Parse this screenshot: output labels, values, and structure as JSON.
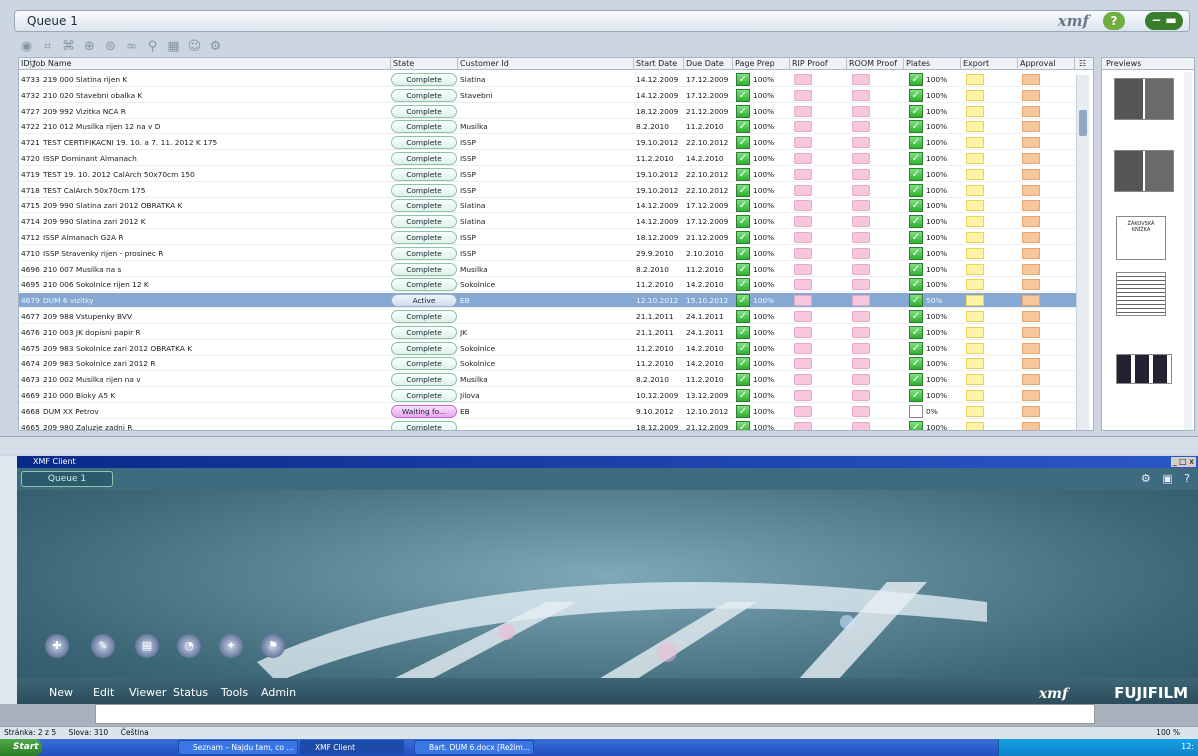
{
  "window": {
    "title": "Queue 1",
    "logo": "xmf",
    "help": "?",
    "minimize": "− ▬"
  },
  "toolbar_icons": [
    "eye-icon",
    "collapse-icon",
    "expand-icon",
    "refresh-icon",
    "filter-icon",
    "link-icon",
    "search-icon",
    "calendar-icon",
    "users-icon",
    "settings-icon"
  ],
  "columns": [
    "ID▽",
    "Job Name",
    "State",
    "Customer Id",
    "Start Date",
    "Due Date",
    "Page Prep",
    "RIP Proof",
    "ROOM Proof",
    "Plates",
    "Export",
    "Approval"
  ],
  "rows": [
    {
      "id": "4733",
      "name": "219 000 Slatina rijen K",
      "state": "Complete",
      "cust": "Slatina",
      "start": "14.12.2009",
      "due": "17.12.2009",
      "prep": "100%",
      "plates": "100%"
    },
    {
      "id": "4732",
      "name": "210 020 Stavebni obalka K",
      "state": "Complete",
      "cust": "Stavebni",
      "start": "14.12.2009",
      "due": "17.12.2009",
      "prep": "100%",
      "plates": "100%"
    },
    {
      "id": "4727",
      "name": "209 992 Vizitka NCA R",
      "state": "Complete",
      "cust": "",
      "start": "18.12.2009",
      "due": "21.12.2009",
      "prep": "100%",
      "plates": "100%"
    },
    {
      "id": "4722",
      "name": "210 012 Musilka rijen 12 na v D",
      "state": "Complete",
      "cust": "Musilka",
      "start": "8.2.2010",
      "due": "11.2.2010",
      "prep": "100%",
      "plates": "100%"
    },
    {
      "id": "4721",
      "name": "TEST CERTIFIKACNI 19. 10. a 7. 11. 2012 K 175",
      "state": "Complete",
      "cust": "ISSP",
      "start": "19.10.2012",
      "due": "22.10.2012",
      "prep": "100%",
      "plates": "100%"
    },
    {
      "id": "4720",
      "name": "ISSP Dominant Almanach",
      "state": "Complete",
      "cust": "ISSP",
      "start": "11.2.2010",
      "due": "14.2.2010",
      "prep": "100%",
      "plates": "100%"
    },
    {
      "id": "4719",
      "name": "TEST 19. 10. 2012 CalArch 50x70cm 150",
      "state": "Complete",
      "cust": "ISSP",
      "start": "19.10.2012",
      "due": "22.10.2012",
      "prep": "100%",
      "plates": "100%"
    },
    {
      "id": "4718",
      "name": "TEST CalArch 50x70cm 175",
      "state": "Complete",
      "cust": "ISSP",
      "start": "19.10.2012",
      "due": "22.10.2012",
      "prep": "100%",
      "plates": "100%"
    },
    {
      "id": "4715",
      "name": "209 990 Slatina zari 2012 OBRATKA K",
      "state": "Complete",
      "cust": "Slatina",
      "start": "14.12.2009",
      "due": "17.12.2009",
      "prep": "100%",
      "plates": "100%"
    },
    {
      "id": "4714",
      "name": "209 990 Slatina zari 2012 K",
      "state": "Complete",
      "cust": "Slatina",
      "start": "14.12.2009",
      "due": "17.12.2009",
      "prep": "100%",
      "plates": "100%"
    },
    {
      "id": "4712",
      "name": "ISSP Almanach G2A R",
      "state": "Complete",
      "cust": "ISSP",
      "start": "18.12.2009",
      "due": "21.12.2009",
      "prep": "100%",
      "plates": "100%"
    },
    {
      "id": "4710",
      "name": "ISSP Stravenky rijen - prosinec R",
      "state": "Complete",
      "cust": "ISSP",
      "start": "29.9.2010",
      "due": "2.10.2010",
      "prep": "100%",
      "plates": "100%"
    },
    {
      "id": "4696",
      "name": "210 007  Musilka na s",
      "state": "Complete",
      "cust": "Musilka",
      "start": "8.2.2010",
      "due": "11.2.2010",
      "prep": "100%",
      "plates": "100%"
    },
    {
      "id": "4695",
      "name": "210 006 Sokolnice rijen 12 K",
      "state": "Complete",
      "cust": "Sokolnice",
      "start": "11.2.2010",
      "due": "14.2.2010",
      "prep": "100%",
      "plates": "100%"
    },
    {
      "id": "4679",
      "name": "DUM 6 vizitky",
      "state": "Active",
      "cust": "EB",
      "start": "12.10.2012",
      "due": "15.10.2012",
      "prep": "100%",
      "plates": "50%",
      "selected": true
    },
    {
      "id": "4677",
      "name": "209 988 Vstupenky BVV",
      "state": "Complete",
      "cust": "",
      "start": "21.1.2011",
      "due": "24.1.2011",
      "prep": "100%",
      "plates": "100%"
    },
    {
      "id": "4676",
      "name": "210 003 JK dopisni papir R",
      "state": "Complete",
      "cust": "JK",
      "start": "21.1.2011",
      "due": "24.1.2011",
      "prep": "100%",
      "plates": "100%"
    },
    {
      "id": "4675",
      "name": "209 983 Sokolnice zari 2012 OBRATKA K",
      "state": "Complete",
      "cust": "Sokolnice",
      "start": "11.2.2010",
      "due": "14.2.2010",
      "prep": "100%",
      "plates": "100%"
    },
    {
      "id": "4674",
      "name": "209 983 Sokolnice zari 2012 R",
      "state": "Complete",
      "cust": "Sokolnice",
      "start": "11.2.2010",
      "due": "14.2.2010",
      "prep": "100%",
      "plates": "100%"
    },
    {
      "id": "4673",
      "name": "210 002 Musilka rijen na v",
      "state": "Complete",
      "cust": "Musilka",
      "start": "8.2.2010",
      "due": "11.2.2010",
      "prep": "100%",
      "plates": "100%"
    },
    {
      "id": "4669",
      "name": "210 000 Bloky A5 K",
      "state": "Complete",
      "cust": "Jilova",
      "start": "10.12.2009",
      "due": "13.12.2009",
      "prep": "100%",
      "plates": "100%"
    },
    {
      "id": "4668",
      "name": "DUM XX Petrov",
      "state": "Waiting fo...",
      "cust": "EB",
      "start": "9.10.2012",
      "due": "12.10.2012",
      "prep": "100%",
      "plates": "0%",
      "waiting": true
    },
    {
      "id": "4665",
      "name": "209 980 Zaluzie zadni R",
      "state": "Complete",
      "cust": "",
      "start": "18.12.2009",
      "due": "21.12.2009",
      "prep": "100%",
      "plates": "100%"
    }
  ],
  "previews": {
    "title": "Previews",
    "thumb1_title": "ŽÁKOVSKÁ",
    "thumb1_sub": "KNÍŽKA"
  },
  "client": {
    "title": "XMF Client",
    "tab": "Queue 1",
    "winbtns": "_ □ x",
    "nav": [
      "New",
      "Edit",
      "Viewer",
      "Status",
      "Tools",
      "Admin"
    ],
    "logo": "xmf",
    "brand": "FUJIFILM"
  },
  "statusbar": {
    "page": "Stránka: 2 z 5",
    "words": "Slova: 310",
    "lang": "Čeština",
    "zoom": "100 %"
  },
  "taskbar": {
    "start": "Start",
    "tasks": [
      "Seznam – Najdu tam, co ...",
      "XMF Client",
      "Bart. DUM 6.docx [Režim..."
    ],
    "clock": "12:"
  }
}
